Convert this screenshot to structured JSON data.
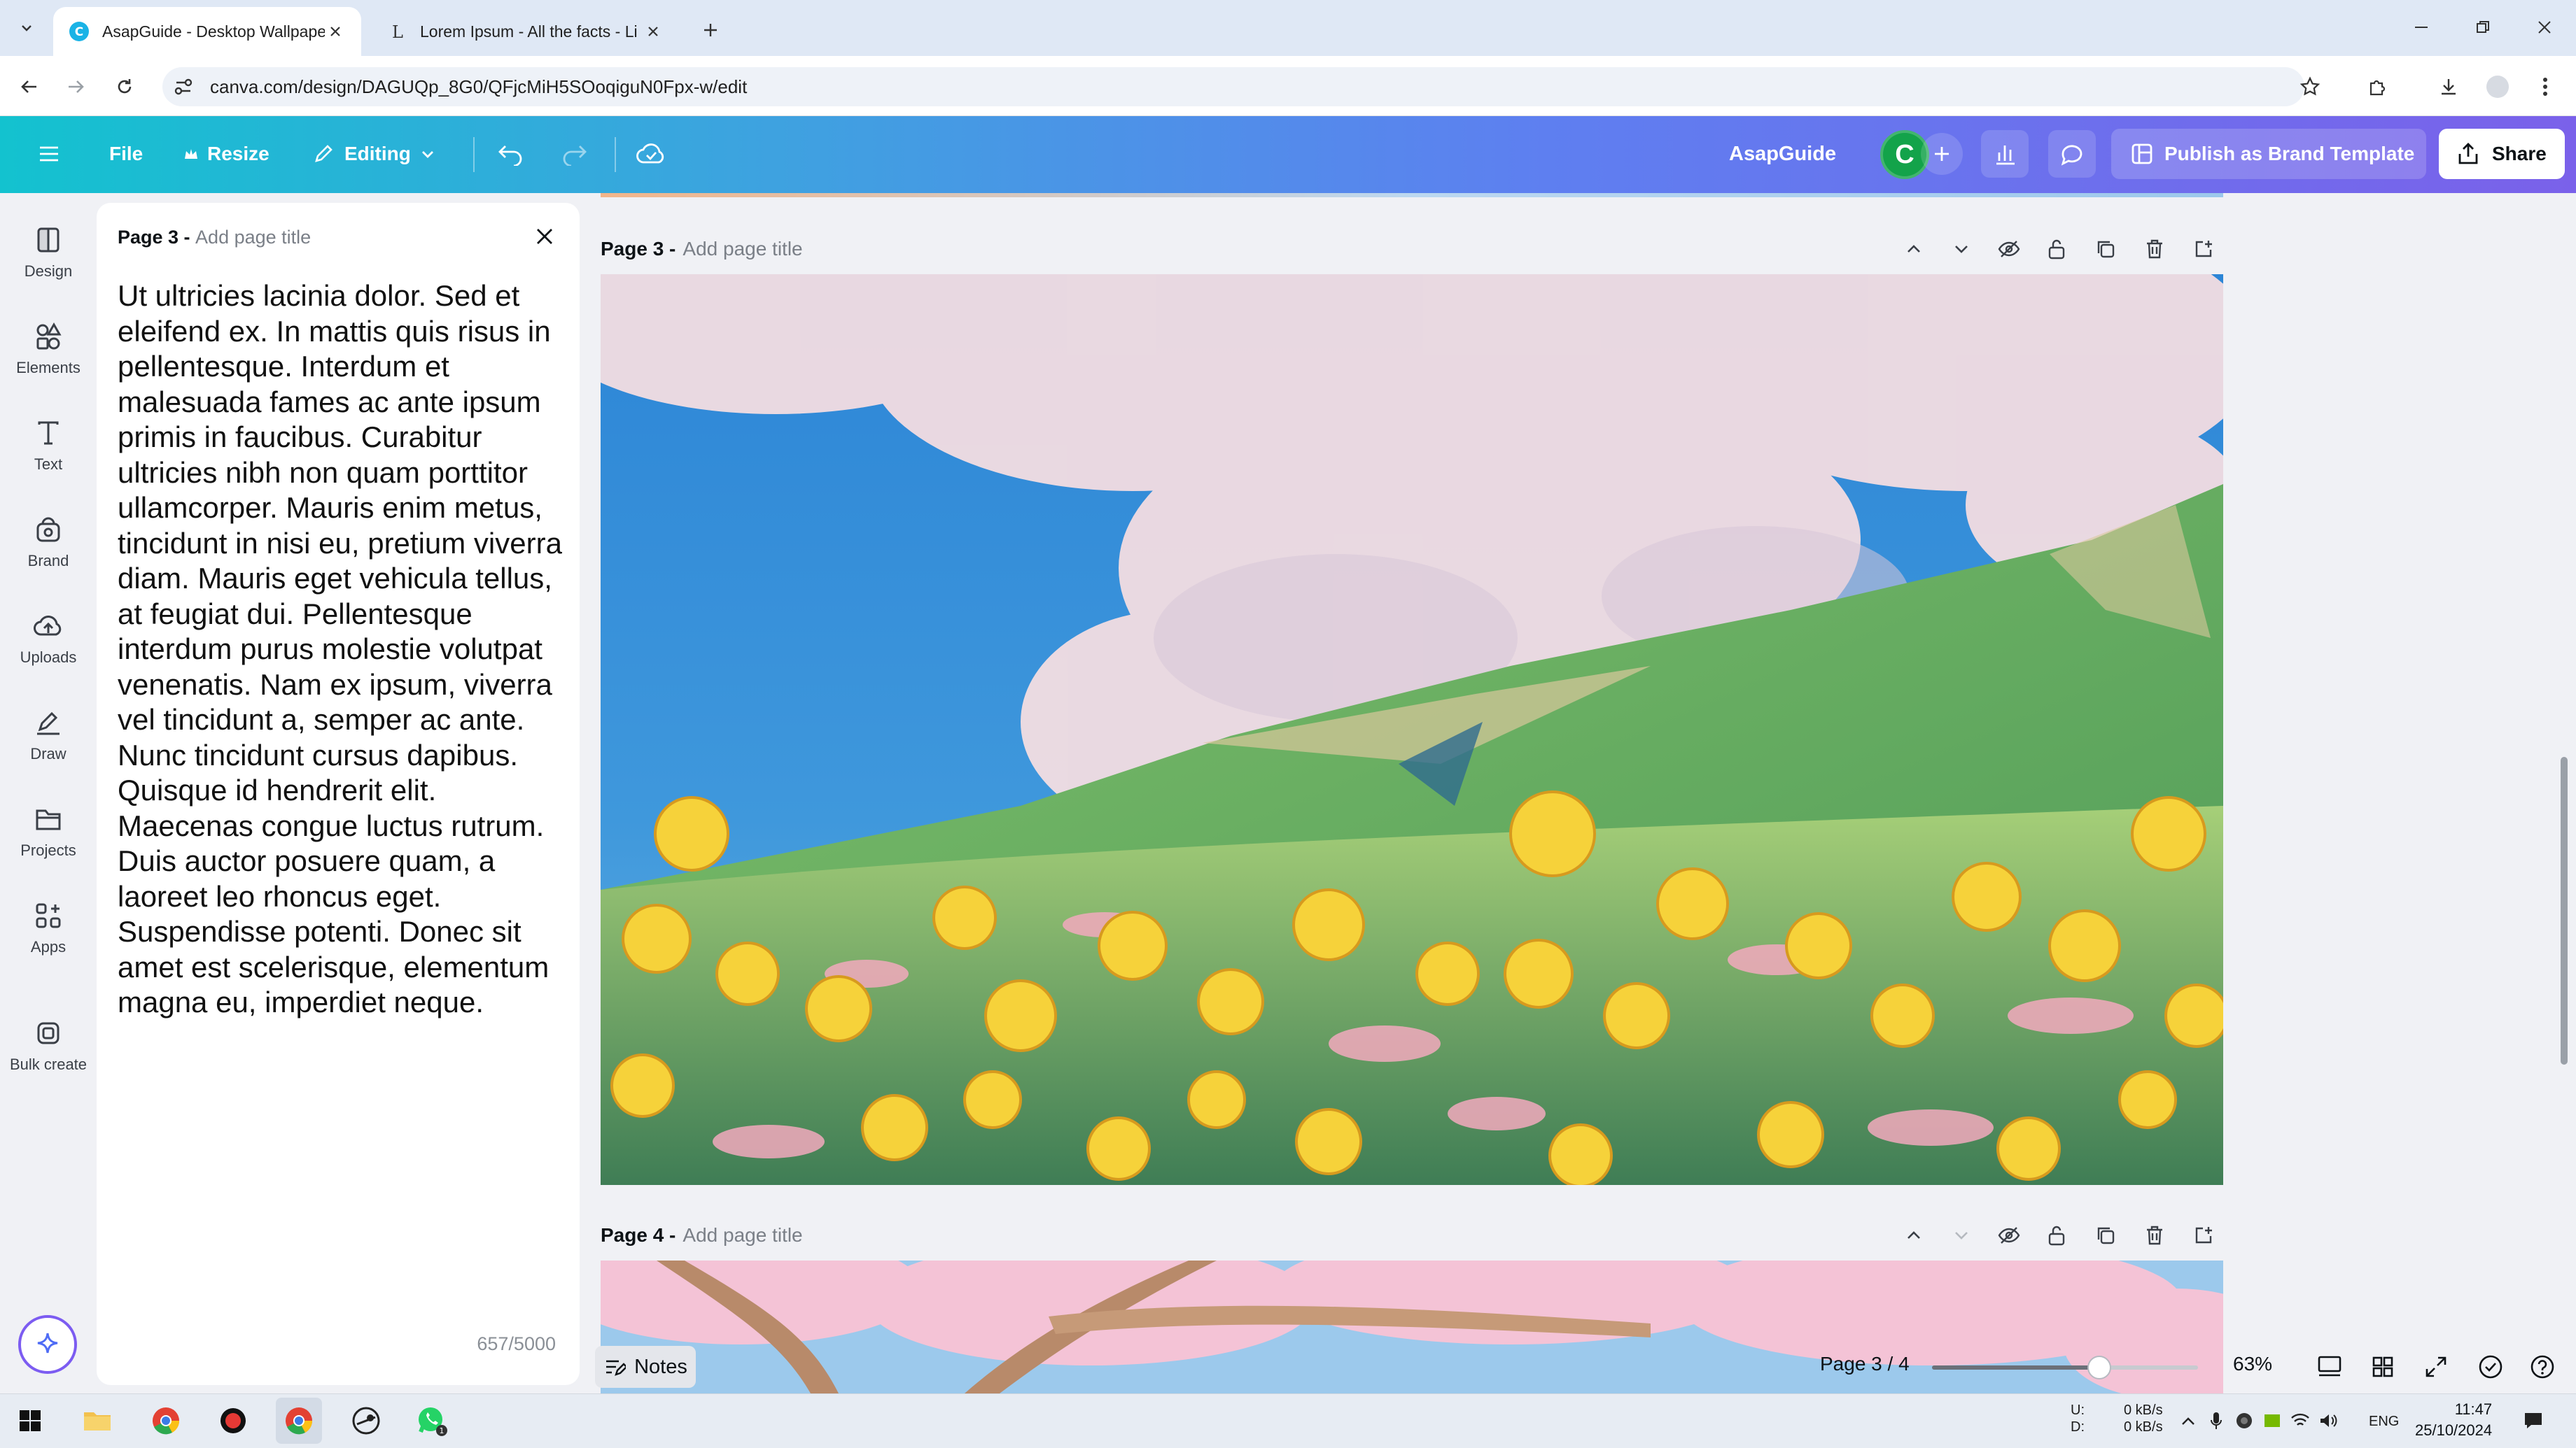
{
  "browser": {
    "tabs": [
      {
        "title": "AsapGuide - Desktop Wallpape",
        "active": true
      },
      {
        "title": "Lorem Ipsum - All the facts - Li",
        "active": false
      }
    ],
    "url": "canva.com/design/DAGUQp_8G0/QFjcMiH5SOoqiguN0Fpx-w/edit"
  },
  "toolbar": {
    "file_label": "File",
    "resize_label": "Resize",
    "editing_label": "Editing",
    "team_name": "AsapGuide",
    "avatar_initial": "C",
    "publish_label": "Publish as Brand Template",
    "share_label": "Share"
  },
  "sidebar": {
    "items": [
      {
        "label": "Design",
        "icon": "design-icon"
      },
      {
        "label": "Elements",
        "icon": "elements-icon"
      },
      {
        "label": "Text",
        "icon": "text-icon"
      },
      {
        "label": "Brand",
        "icon": "brand-icon"
      },
      {
        "label": "Uploads",
        "icon": "uploads-icon"
      },
      {
        "label": "Draw",
        "icon": "draw-icon"
      },
      {
        "label": "Projects",
        "icon": "projects-icon"
      },
      {
        "label": "Apps",
        "icon": "apps-icon"
      },
      {
        "label": "Bulk create",
        "icon": "bulk-create-icon"
      }
    ]
  },
  "notes": {
    "page_label": "Page 3 - ",
    "title_placeholder": "Add page title",
    "text": "Ut ultricies lacinia dolor. Sed et eleifend ex. In mattis quis risus in pellentesque. Interdum et malesuada fames ac ante ipsum primis in faucibus. Curabitur ultricies nibh non quam porttitor ullamcorper. Mauris enim metus, tincidunt in nisi eu, pretium viverra diam. Mauris eget vehicula tellus, at feugiat dui. Pellentesque interdum purus molestie volutpat venenatis. Nam ex ipsum, viverra vel tincidunt a, semper ac ante. Nunc tincidunt cursus dapibus. Quisque id hendrerit elit. Maecenas congue luctus rutrum. Duis auctor posuere quam, a laoreet leo rhoncus eget. Suspendisse potenti. Donec sit amet est scelerisque, elementum magna eu, imperdiet neque.",
    "char_count": "657/5000"
  },
  "pages": [
    {
      "label": "Page 3 - ",
      "title_placeholder": "Add page title"
    },
    {
      "label": "Page 4 - ",
      "title_placeholder": "Add page title"
    }
  ],
  "footer": {
    "notes_label": "Notes",
    "page_indicator": "Page 3 / 4",
    "zoom": "63%",
    "zoom_fraction": 0.63
  },
  "taskbar": {
    "net_up": "0 kB/s",
    "net_down": "0 kB/s",
    "net_u": "U:",
    "net_d": "D:",
    "lang": "ENG",
    "time": "11:47",
    "date": "25/10/2024"
  },
  "colors": {
    "header_gradient_start": "#13c2cf",
    "header_gradient_end": "#7a61ea",
    "avatar": "#13a34a",
    "ai_accent": "#7c5cf1"
  }
}
